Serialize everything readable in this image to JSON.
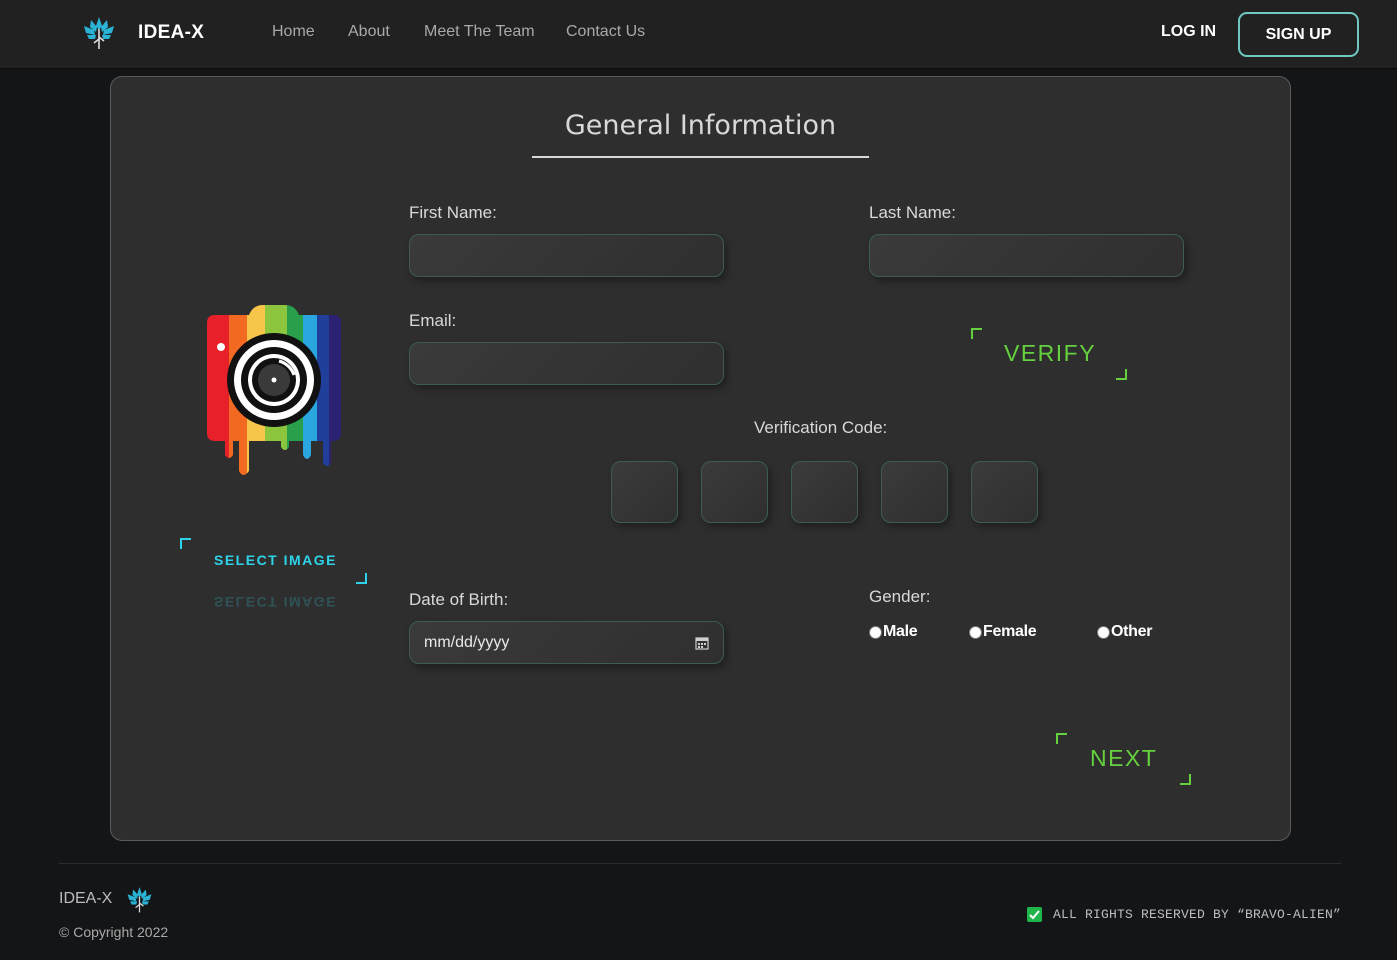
{
  "nav": {
    "brand": "IDEA-X",
    "links": [
      "Home",
      "About",
      "Meet The Team",
      "Contact Us"
    ],
    "login": "LOG IN",
    "signup": "SIGN UP"
  },
  "form": {
    "title": "General Information",
    "first_name_label": "First Name:",
    "last_name_label": "Last Name:",
    "email_label": "Email:",
    "verify_button": "VERIFY",
    "verification_code_label": "Verification Code:",
    "code_box_count": 5,
    "select_image_button": "SELECT IMAGE",
    "dob_label": "Date of Birth:",
    "dob_placeholder": "mm/dd/yyyy",
    "gender_label": "Gender:",
    "gender_options": [
      "Male",
      "Female",
      "Other"
    ],
    "next_button": "NEXT"
  },
  "footer": {
    "brand": "IDEA-X",
    "copyright": "© Copyright 2022",
    "rights": "ALL RIGHTS RESERVED BY “BRAVO-ALIEN”"
  },
  "colors": {
    "accent_green": "#66d13e",
    "accent_cyan": "#2ed3e9",
    "signup_border": "#6fc9c2",
    "card_bg": "#2e2e2e",
    "page_bg": "#141517"
  },
  "icons": {
    "brand_logo": "tree-logo-icon",
    "profile_image": "rainbow-camera-icon",
    "calendar": "calendar-icon",
    "rights_check": "checkbox-checked-icon"
  }
}
